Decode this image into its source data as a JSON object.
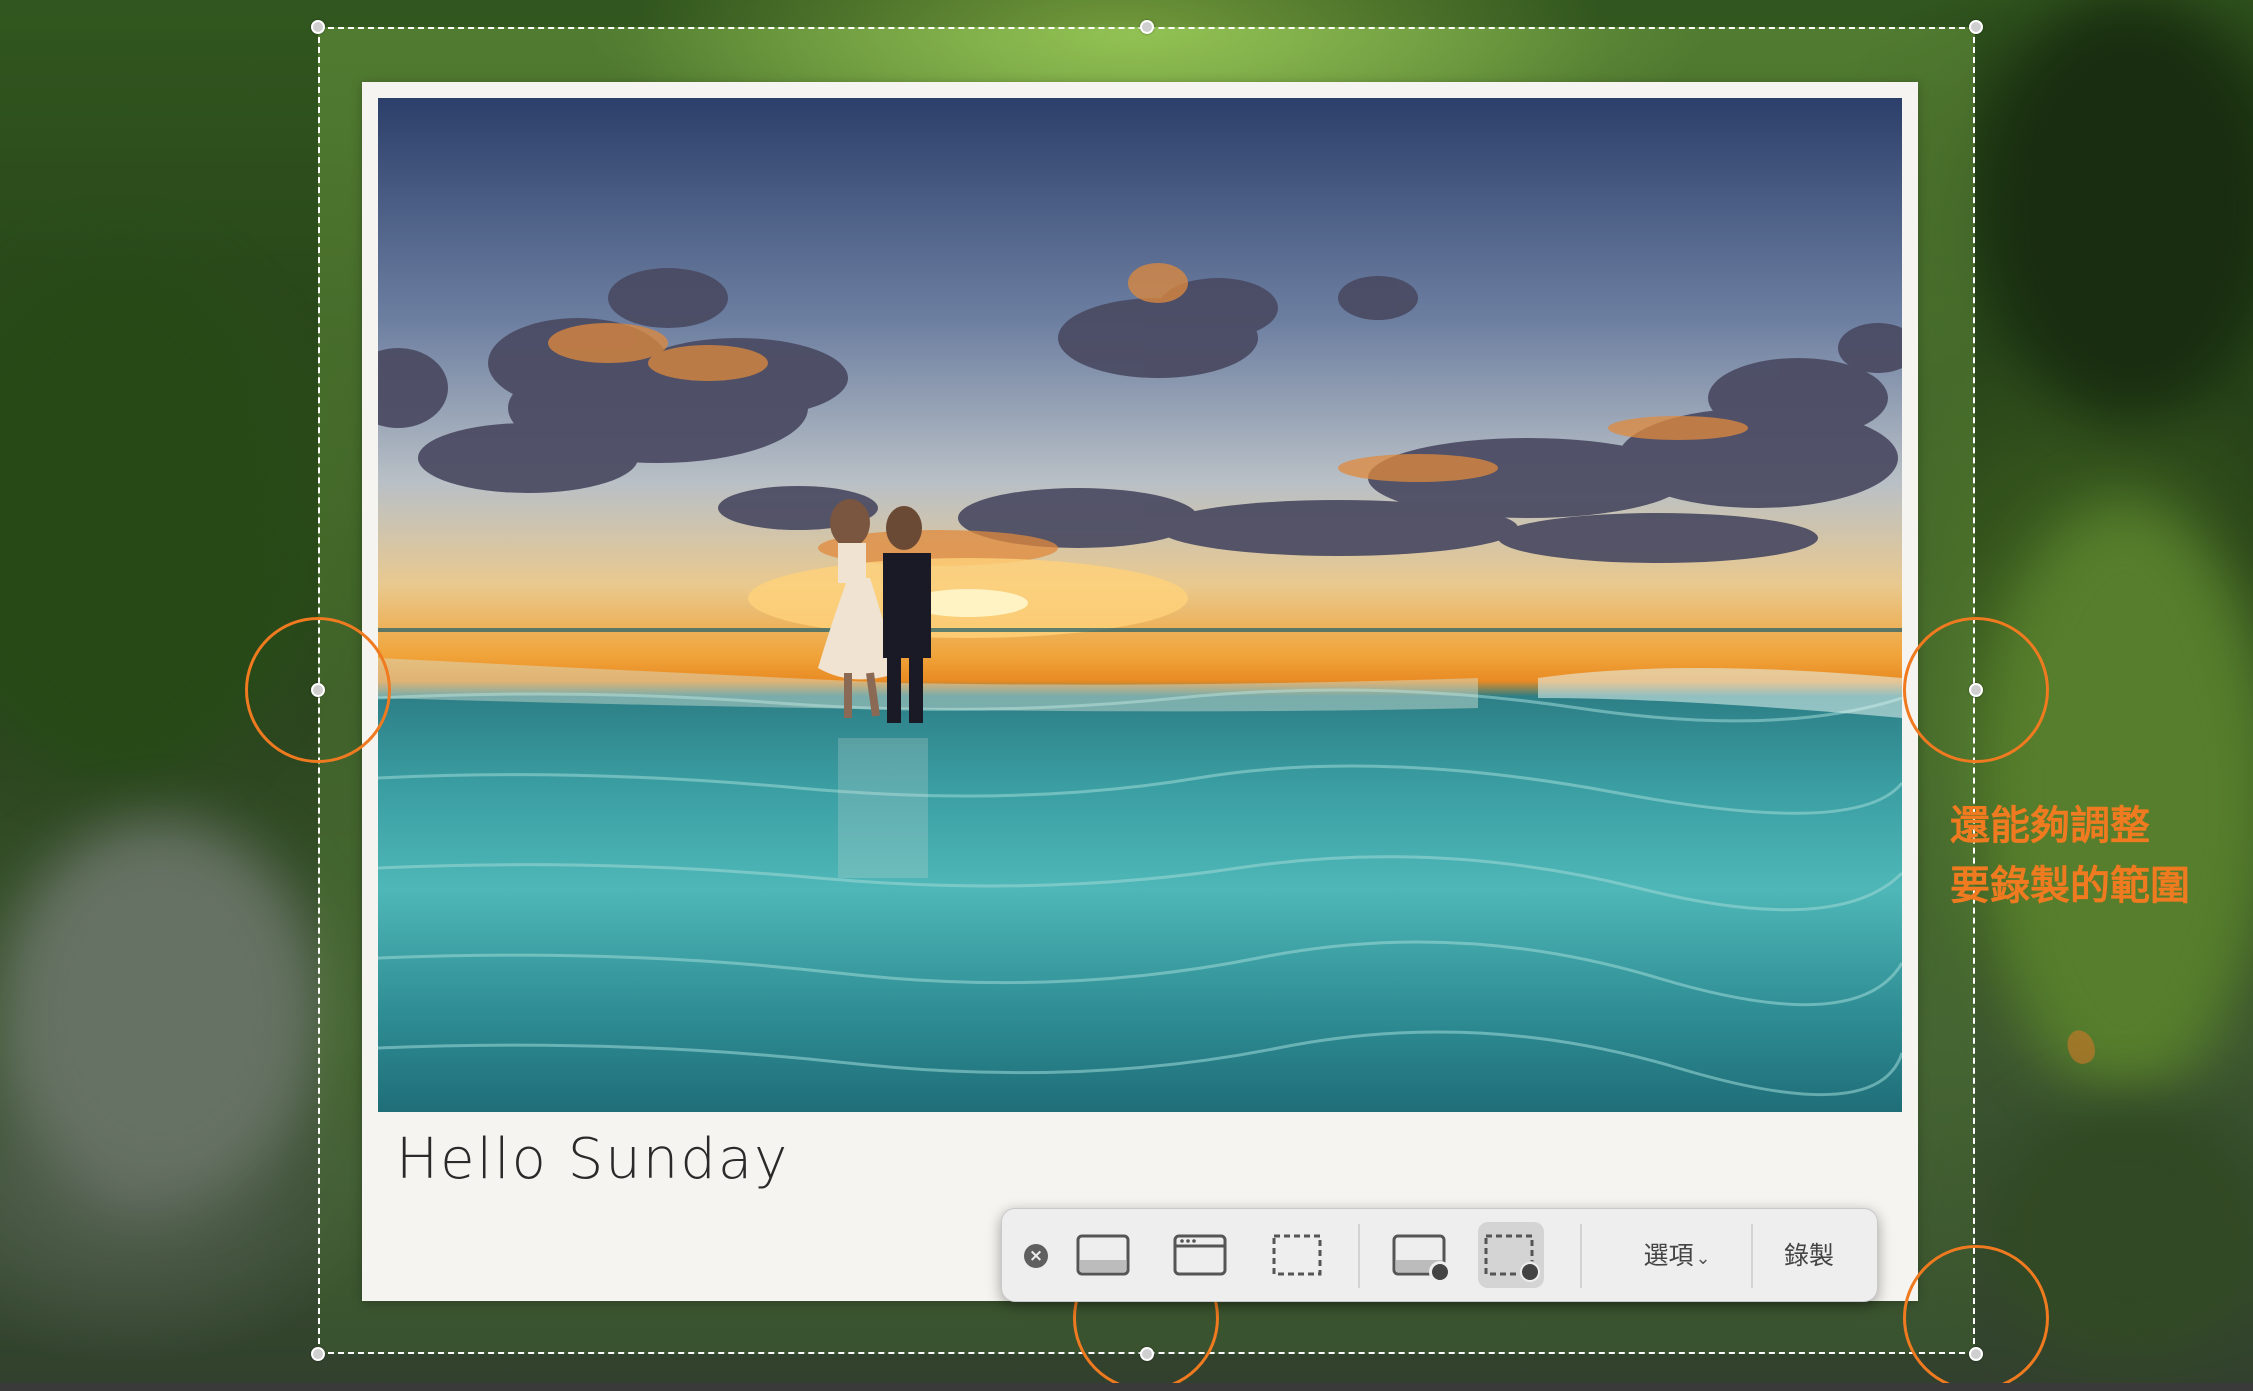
{
  "caption": "Hello Sunday",
  "toolbar": {
    "close_icon": "close-icon",
    "buttons": [
      {
        "icon": "capture-entire-screen-icon",
        "selected": false
      },
      {
        "icon": "capture-window-icon",
        "selected": false
      },
      {
        "icon": "capture-selection-icon",
        "selected": false
      },
      {
        "icon": "record-entire-screen-icon",
        "selected": false
      },
      {
        "icon": "record-selection-icon",
        "selected": true
      }
    ],
    "options_label": "選項",
    "record_label": "錄製"
  },
  "annotation": {
    "line1": "還能夠調整",
    "line2": "要錄製的範圍",
    "color": "#ef7a1f"
  },
  "colors": {
    "accent": "#ef7a1f",
    "toolbar_bg": "#eeeeee",
    "selection_border": "#ffffff"
  }
}
